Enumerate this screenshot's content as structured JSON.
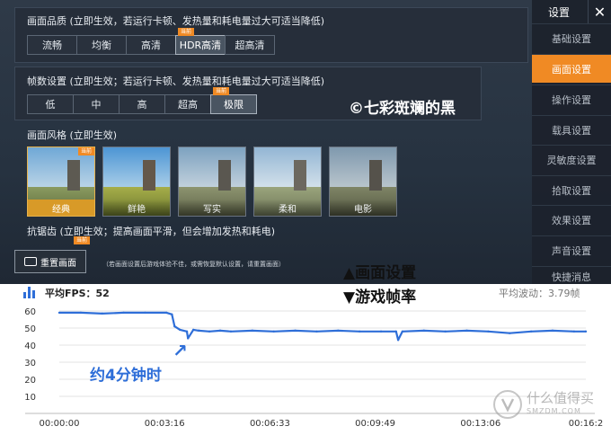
{
  "settings": {
    "quality": {
      "label": "画面品质 (立即生效，若运行卡顿、发热量和耗电量过大可适当降低)",
      "options": [
        "流畅",
        "均衡",
        "高清",
        "HDR高清",
        "超高清"
      ],
      "current_tag": "当前"
    },
    "framerate": {
      "label": "帧数设置 (立即生效；若运行卡顿、发热量和耗电量过大可适当降低)",
      "options": [
        "低",
        "中",
        "高",
        "超高",
        "极限"
      ],
      "current_tag": "当前"
    },
    "style": {
      "label": "画面风格 (立即生效)",
      "options": [
        "经典",
        "鲜艳",
        "写实",
        "柔和",
        "电影"
      ],
      "current_tag": "当前"
    },
    "antialias": {
      "label": "抗锯齿 (立即生效；提高画面平滑，但会增加发热和耗电)",
      "current_tag": "当前"
    },
    "reset_button": "重置画面",
    "reset_note": "（若画面设置后游戏体验不佳，或需恢复默认设置，请重置画面）",
    "watermark": "©七彩斑斓的黑"
  },
  "sidebar": {
    "title": "设置",
    "close": "✕",
    "items": [
      "基础设置",
      "画面设置",
      "操作设置",
      "载具设置",
      "灵敏度设置",
      "拾取设置",
      "效果设置",
      "声音设置",
      "快捷消息"
    ]
  },
  "captions": {
    "settings": "▲画面设置",
    "fps": "▼游戏帧率"
  },
  "chart": {
    "avg_label": "平均FPS：",
    "avg_value": "52",
    "wave_label": "平均波动：",
    "wave_value": "3.79帧",
    "annotation": "约4分钟时",
    "arrow": "↗",
    "line_color": "#2e6ed8",
    "ui_accent": "#f08a24"
  },
  "chart_data": {
    "type": "line",
    "ylim": [
      0,
      60
    ],
    "yticks": [
      10,
      20,
      30,
      40,
      50,
      60
    ],
    "xtick_labels": [
      "00:00:00",
      "00:03:16",
      "00:06:33",
      "00:09:49",
      "00:13:06",
      "00:16:2"
    ],
    "x_unit": "seconds",
    "x_range": [
      0,
      982
    ],
    "series": [
      {
        "x": [
          0,
          40,
          80,
          120,
          160,
          200,
          210,
          215,
          225,
          238,
          240,
          250,
          260,
          280,
          300,
          320,
          360,
          400,
          440,
          480,
          520,
          560,
          600,
          628,
          632,
          640,
          680,
          720,
          760,
          800,
          840,
          880,
          920,
          960,
          982
        ],
        "y": [
          59,
          59,
          58.5,
          59,
          59,
          59,
          58,
          51,
          49,
          48,
          44,
          49,
          48.5,
          48,
          48.5,
          48,
          48.5,
          48,
          48.5,
          48,
          48.5,
          48,
          48,
          48,
          43,
          48,
          48.5,
          48,
          48.5,
          48,
          47,
          48,
          48.5,
          48,
          48
        ]
      }
    ]
  },
  "brand": {
    "text": "什么值得买",
    "sub": "SMZDM.COM"
  }
}
